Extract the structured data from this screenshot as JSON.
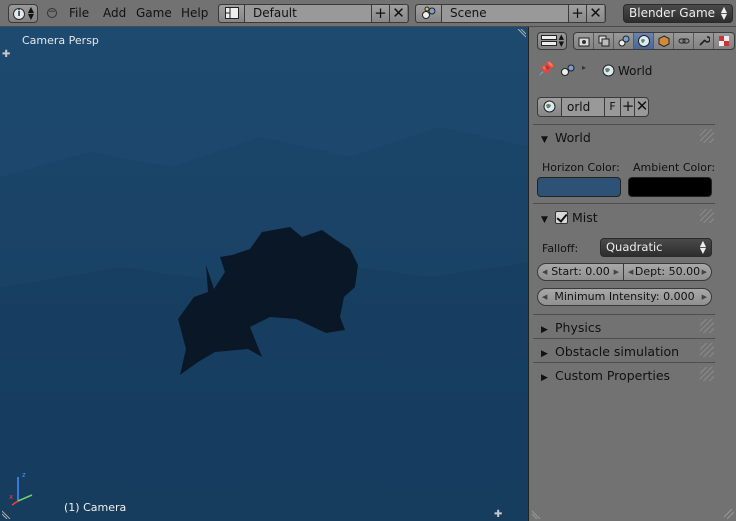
{
  "menus": [
    "File",
    "Add",
    "Game",
    "Help"
  ],
  "layout_field": {
    "value": "Default"
  },
  "scene_field": {
    "value": "Scene"
  },
  "render_engine": {
    "value": "Blender Game"
  },
  "viewport": {
    "view_label": "Camera Persp",
    "object_label": "(1) Camera",
    "background_top": "#1e4a70",
    "background_bottom": "#16395a"
  },
  "properties": {
    "breadcrumb": "World",
    "datablock_name": "orld",
    "fake_user": "F",
    "world_panel": {
      "title": "World",
      "horizon_label": "Horizon Color:",
      "ambient_label": "Ambient Color:",
      "horizon_color": "#2d5276",
      "ambient_color": "#000000"
    },
    "mist_panel": {
      "title": "Mist",
      "enabled": true,
      "falloff_label": "Falloff:",
      "falloff_value": "Quadratic",
      "start": "Start: 0.00",
      "depth": "Dept: 50.00",
      "min_intensity": "Minimum Intensity: 0.000"
    },
    "collapsed_panels": [
      "Physics",
      "Obstacle simulation",
      "Custom Properties"
    ]
  }
}
